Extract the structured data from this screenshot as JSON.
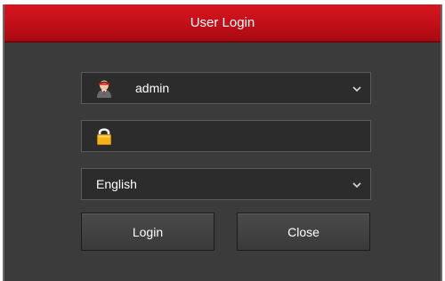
{
  "dialog": {
    "title": "User Login",
    "title_color": "#c8141c"
  },
  "username": {
    "value": "admin",
    "icon": "user-avatar-icon"
  },
  "password": {
    "value": "",
    "icon": "lock-icon"
  },
  "language": {
    "selected": "English"
  },
  "buttons": {
    "login_label": "Login",
    "close_label": "Close"
  }
}
